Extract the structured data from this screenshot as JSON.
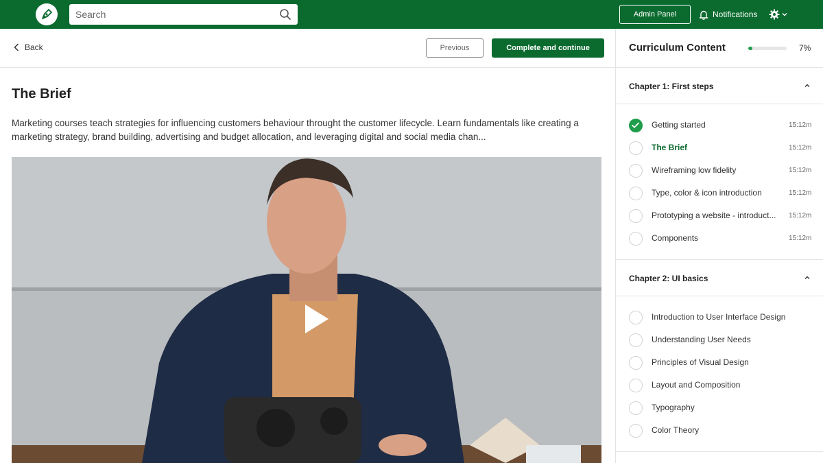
{
  "topbar": {
    "search_placeholder": "Search",
    "admin_label": "Admin Panel",
    "notifications_label": "Notifications"
  },
  "subbar": {
    "back_label": "Back",
    "previous_label": "Previous",
    "complete_label": "Complete and continue"
  },
  "lesson": {
    "title": "The Brief",
    "description": "Marketing courses teach strategies for influencing customers behaviour throught the customer lifecycle. Learn fundamentals like creating a marketing strategy, brand building, advertising and budget allocation, and leveraging digital and social media chan..."
  },
  "curriculum": {
    "title": "Curriculum Content",
    "progress_percent": 7,
    "progress_label": "7%",
    "chapters": [
      {
        "title": "Chapter 1: First steps",
        "lessons": [
          {
            "name": "Getting started",
            "duration": "15:12m",
            "completed": true,
            "active": false
          },
          {
            "name": "The Brief",
            "duration": "15:12m",
            "completed": false,
            "active": true
          },
          {
            "name": "Wireframing low fidelity",
            "duration": "15:12m",
            "completed": false,
            "active": false
          },
          {
            "name": "Type, color & icon introduction",
            "duration": "15:12m",
            "completed": false,
            "active": false
          },
          {
            "name": "Prototyping a website - introduct...",
            "duration": "15:12m",
            "completed": false,
            "active": false
          },
          {
            "name": "Components",
            "duration": "15:12m",
            "completed": false,
            "active": false
          }
        ]
      },
      {
        "title": "Chapter 2: UI basics",
        "lessons": [
          {
            "name": "Introduction to User Interface Design"
          },
          {
            "name": "Understanding User Needs"
          },
          {
            "name": "Principles of Visual Design"
          },
          {
            "name": "Layout and Composition"
          },
          {
            "name": "Typography"
          },
          {
            "name": "Color Theory"
          }
        ]
      }
    ]
  },
  "colors": {
    "brand": "#0b6b2f",
    "accent": "#1f9d4a"
  }
}
